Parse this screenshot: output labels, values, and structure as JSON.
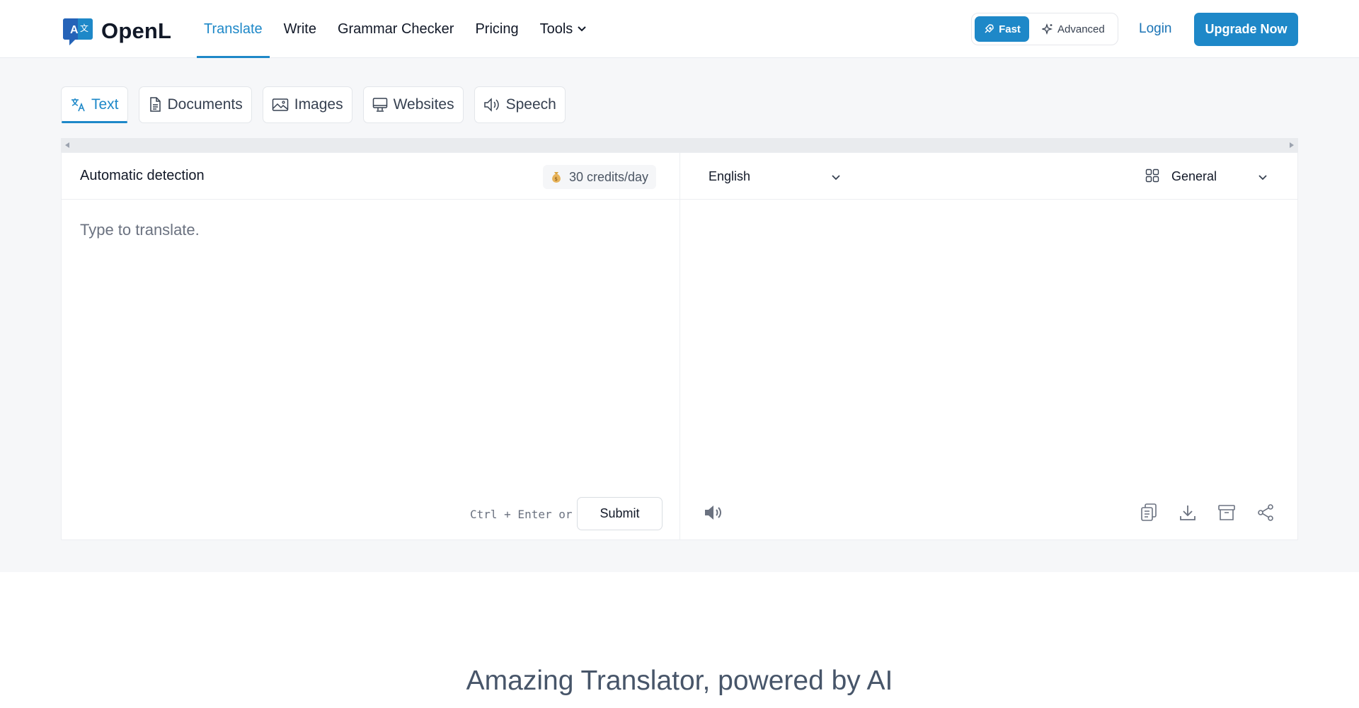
{
  "brand": {
    "name": "OpenL",
    "logo_letters": [
      "A",
      "文"
    ]
  },
  "nav": {
    "items": [
      {
        "label": "Translate",
        "active": true
      },
      {
        "label": "Write"
      },
      {
        "label": "Grammar Checker"
      },
      {
        "label": "Pricing"
      },
      {
        "label": "Tools",
        "has_dropdown": true
      }
    ]
  },
  "mode": {
    "fast_label": "Fast",
    "advanced_label": "Advanced",
    "selected": "Fast"
  },
  "auth": {
    "login_label": "Login",
    "upgrade_label": "Upgrade Now"
  },
  "tabs": [
    {
      "label": "Text",
      "icon": "translate-icon",
      "active": true
    },
    {
      "label": "Documents",
      "icon": "document-icon"
    },
    {
      "label": "Images",
      "icon": "image-icon"
    },
    {
      "label": "Websites",
      "icon": "monitor-icon"
    },
    {
      "label": "Speech",
      "icon": "speaker-icon"
    }
  ],
  "source": {
    "language": "Automatic detection",
    "credits": "30 credits/day",
    "placeholder": "Type to translate.",
    "shortcut": "Ctrl + Enter or",
    "submit_label": "Submit"
  },
  "target": {
    "language": "English",
    "domain": "General",
    "actions": [
      "copy-icon",
      "download-icon",
      "archive-icon",
      "share-icon"
    ]
  },
  "headline": "Amazing Translator, powered by AI",
  "colors": {
    "accent": "#1e88c8",
    "link": "#1a73b5",
    "background_gray": "#f6f7f9"
  }
}
